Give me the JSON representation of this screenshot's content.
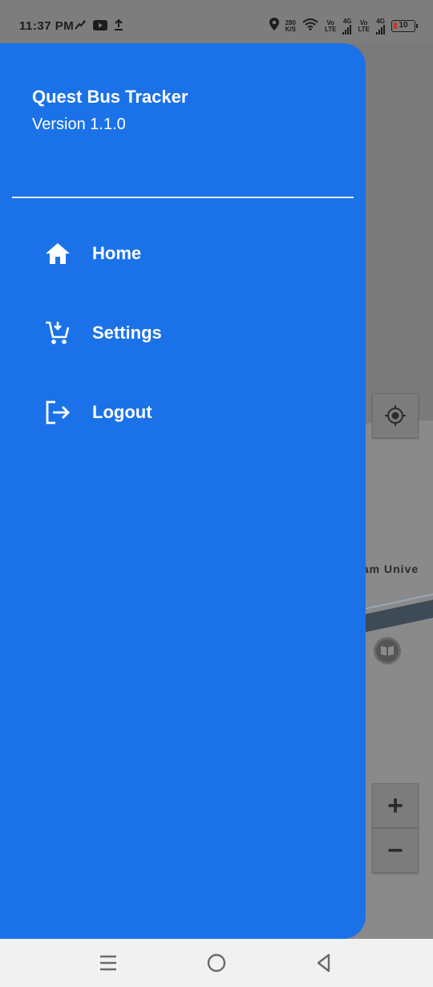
{
  "status_bar": {
    "time": "11:37 PM",
    "net_speed_value": "280",
    "net_speed_unit": "K/S",
    "sim1_top": "Vo",
    "sim1_bottom": "LTE",
    "sim1_net": "4G",
    "sim2_top": "Vo",
    "sim2_bottom": "LTE",
    "sim2_net": "4G",
    "battery": "10",
    "battery_low_color": "#c0392b"
  },
  "drawer": {
    "title": "Quest Bus Tracker",
    "version": "Version 1.1.0",
    "background_color": "#1b72e8",
    "items": [
      {
        "label": "Home",
        "icon": "home-icon"
      },
      {
        "label": "Settings",
        "icon": "cart-icon"
      },
      {
        "label": "Logout",
        "icon": "logout-icon"
      }
    ]
  },
  "map": {
    "label": "wam Unive",
    "zoom_in": "+",
    "zoom_out": "−"
  },
  "nav_bar": {
    "icons": [
      "menu-icon",
      "home-circle-icon",
      "back-icon"
    ]
  }
}
